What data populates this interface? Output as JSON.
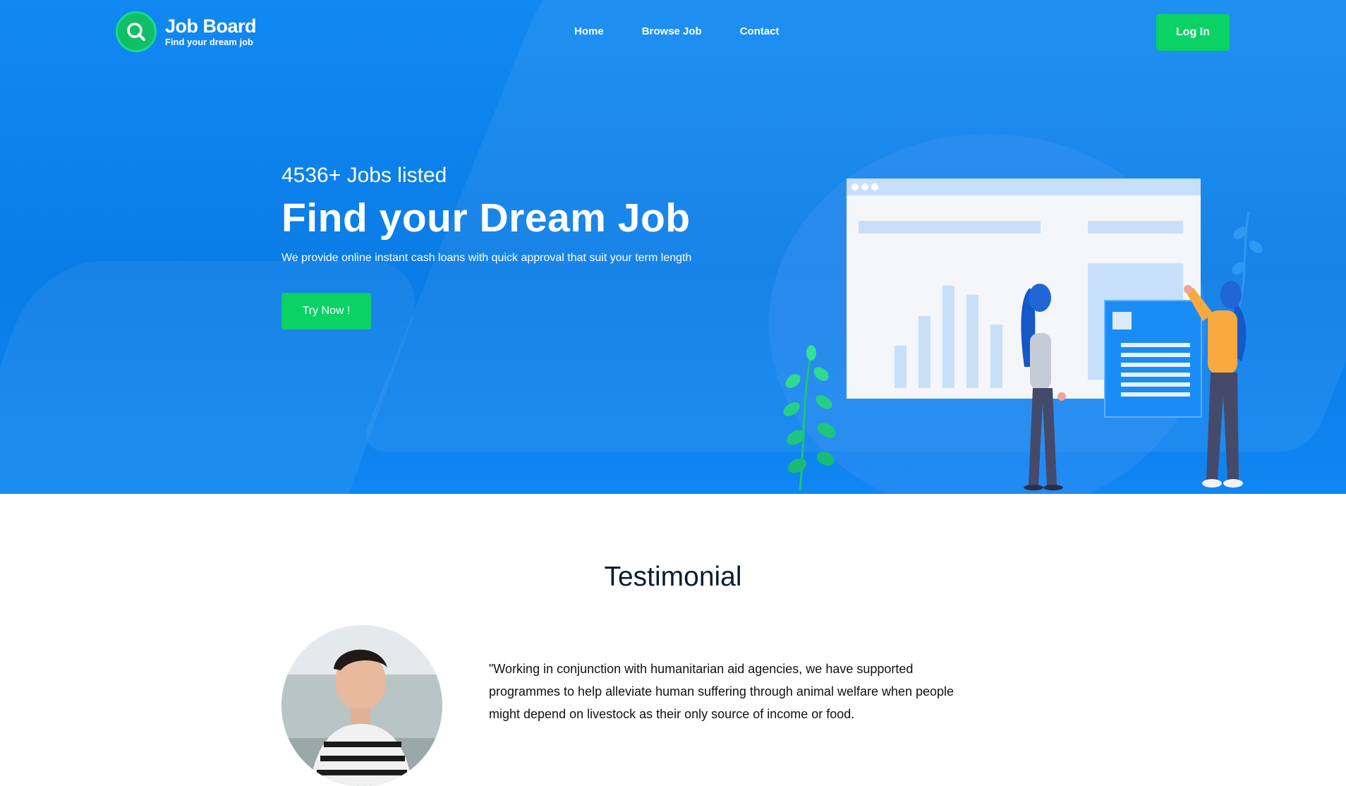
{
  "brand": {
    "name": "Job Board",
    "tagline": "Find your dream job"
  },
  "nav": {
    "items": [
      "Home",
      "Browse Job",
      "Contact"
    ],
    "login": "Log In"
  },
  "hero": {
    "stat": "4536+ Jobs listed",
    "headline": "Find your Dream Job",
    "subtext": "We provide online instant cash loans with quick approval that suit your term length",
    "cta": "Try Now !"
  },
  "testimonial": {
    "title": "Testimonial",
    "quote": "\"Working in conjunction with humanitarian aid agencies, we have supported programmes to help alleviate human suffering through animal welfare when people might depend on livestock as their only source of income or food."
  },
  "colors": {
    "primary_blue": "#0a7ce6",
    "accent_green": "#0ad265",
    "heading_dark": "#0d1b33"
  }
}
